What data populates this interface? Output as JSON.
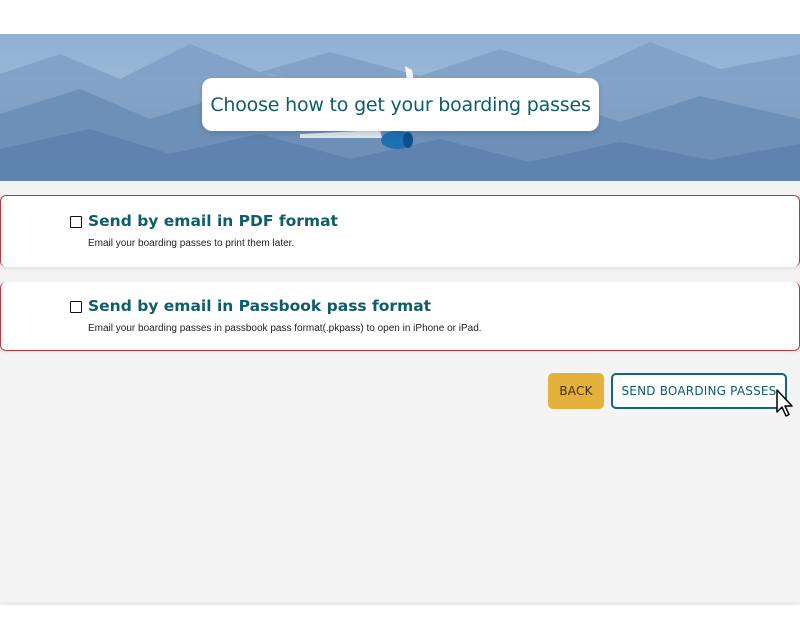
{
  "hero": {
    "title": "Choose how to get your boarding passes"
  },
  "options": [
    {
      "title": "Send by email in PDF format",
      "description": "Email your boarding passes to print them later.",
      "checked": false
    },
    {
      "title": "Send by email in Passbook pass format",
      "description": "Email your boarding passes in passbook pass format(.pkpass) to open in iPhone or iPad.",
      "checked": false
    }
  ],
  "actions": {
    "back_label": "BACK",
    "send_label": "SEND BOARDING PASSES"
  },
  "colors": {
    "brand_teal": "#0f5c6b",
    "accent_yellow": "#e3b13c",
    "error_red": "#c0373a"
  }
}
